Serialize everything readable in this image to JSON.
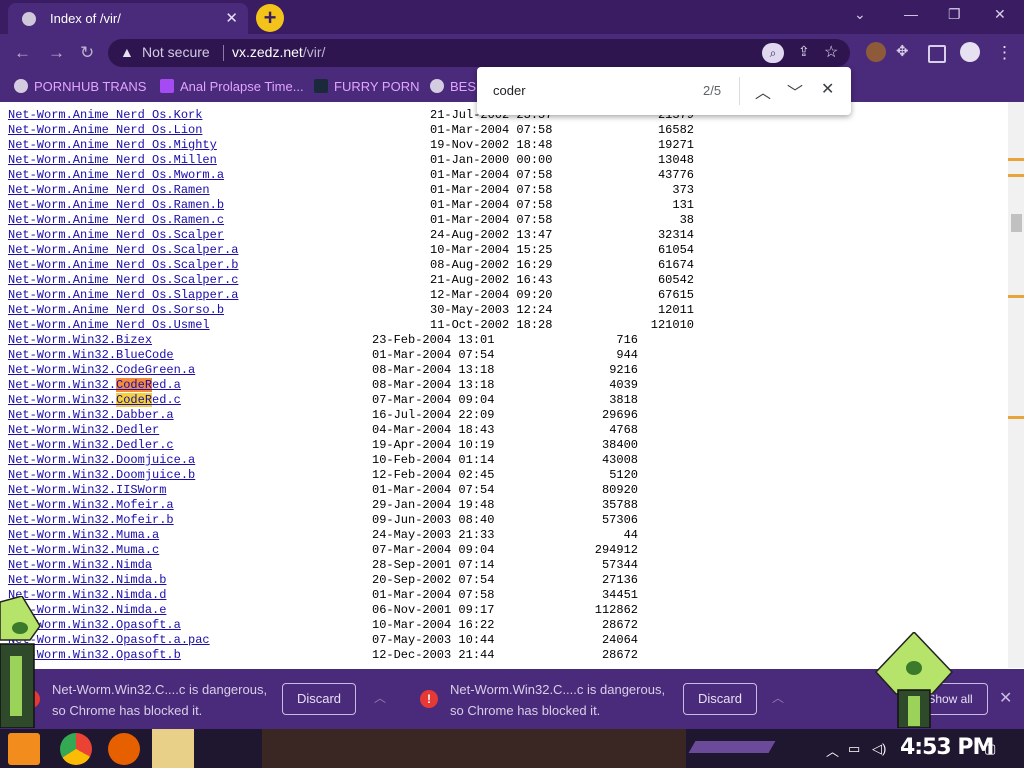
{
  "tab": {
    "title": "Index of /vir/",
    "close": "✕"
  },
  "toolbar": {
    "not_secure": "Not secure",
    "url_host": "vx.zedz.net",
    "url_path": "/vir/"
  },
  "bookmarks": [
    {
      "label": "PORNHUB TRANS"
    },
    {
      "label": "Anal Prolapse Time..."
    },
    {
      "label": "FURRY PORN"
    },
    {
      "label": "BES"
    }
  ],
  "find": {
    "query": "coder",
    "count": "2/5"
  },
  "listing_a": [
    {
      "name": "Net-Worm.Anime Nerd Os.Kork",
      "date": "21-Jul-2002 23:57",
      "size": "21379"
    },
    {
      "name": "Net-Worm.Anime Nerd Os.Lion",
      "date": "01-Mar-2004 07:58",
      "size": "16582"
    },
    {
      "name": "Net-Worm.Anime Nerd Os.Mighty",
      "date": "19-Nov-2002 18:48",
      "size": "19271"
    },
    {
      "name": "Net-Worm.Anime Nerd Os.Millen",
      "date": "01-Jan-2000 00:00",
      "size": "13048"
    },
    {
      "name": "Net-Worm.Anime Nerd Os.Mworm.a",
      "date": "01-Mar-2004 07:58",
      "size": "43776"
    },
    {
      "name": "Net-Worm.Anime Nerd Os.Ramen",
      "date": "01-Mar-2004 07:58",
      "size": "373"
    },
    {
      "name": "Net-Worm.Anime Nerd Os.Ramen.b",
      "date": "01-Mar-2004 07:58",
      "size": "131"
    },
    {
      "name": "Net-Worm.Anime Nerd Os.Ramen.c",
      "date": "01-Mar-2004 07:58",
      "size": "38"
    },
    {
      "name": "Net-Worm.Anime Nerd Os.Scalper",
      "date": "24-Aug-2002 13:47",
      "size": "32314"
    },
    {
      "name": "Net-Worm.Anime Nerd Os.Scalper.a",
      "date": "10-Mar-2004 15:25",
      "size": "61054"
    },
    {
      "name": "Net-Worm.Anime Nerd Os.Scalper.b",
      "date": "08-Aug-2002 16:29",
      "size": "61674"
    },
    {
      "name": "Net-Worm.Anime Nerd Os.Scalper.c",
      "date": "21-Aug-2002 16:43",
      "size": "60542"
    },
    {
      "name": "Net-Worm.Anime Nerd Os.Slapper.a",
      "date": "12-Mar-2004 09:20",
      "size": "67615"
    },
    {
      "name": "Net-Worm.Anime Nerd Os.Sorso.b",
      "date": "30-May-2003 12:24",
      "size": "12011"
    },
    {
      "name": "Net-Worm.Anime Nerd Os.Usmel",
      "date": "11-Oct-2002 18:28",
      "size": "121010"
    }
  ],
  "listing_b": [
    {
      "name": "Net-Worm.Win32.Bizex",
      "date": "23-Feb-2004 13:01",
      "size": "716"
    },
    {
      "name": "Net-Worm.Win32.BlueCode",
      "date": "01-Mar-2004 07:54",
      "size": "944"
    },
    {
      "name": "Net-Worm.Win32.CodeGreen.a",
      "date": "08-Mar-2004 13:18",
      "size": "9216"
    },
    {
      "name": "Net-Worm.Win32.CodeRed.a",
      "date": "08-Mar-2004 13:18",
      "size": "4039"
    },
    {
      "name": "Net-Worm.Win32.CodeRed.c",
      "date": "07-Mar-2004 09:04",
      "size": "3818"
    },
    {
      "name": "Net-Worm.Win32.Dabber.a",
      "date": "16-Jul-2004 22:09",
      "size": "29696"
    },
    {
      "name": "Net-Worm.Win32.Dedler",
      "date": "04-Mar-2004 18:43",
      "size": "4768"
    },
    {
      "name": "Net-Worm.Win32.Dedler.c",
      "date": "19-Apr-2004 10:19",
      "size": "38400"
    },
    {
      "name": "Net-Worm.Win32.Doomjuice.a",
      "date": "10-Feb-2004 01:14",
      "size": "43008"
    },
    {
      "name": "Net-Worm.Win32.Doomjuice.b",
      "date": "12-Feb-2004 02:45",
      "size": "5120"
    },
    {
      "name": "Net-Worm.Win32.IISWorm",
      "date": "01-Mar-2004 07:54",
      "size": "80920"
    },
    {
      "name": "Net-Worm.Win32.Mofeir.a",
      "date": "29-Jan-2004 19:48",
      "size": "35788"
    },
    {
      "name": "Net-Worm.Win32.Mofeir.b",
      "date": "09-Jun-2003 08:40",
      "size": "57306"
    },
    {
      "name": "Net-Worm.Win32.Muma.a",
      "date": "24-May-2003 21:33",
      "size": "44"
    },
    {
      "name": "Net-Worm.Win32.Muma.c",
      "date": "07-Mar-2004 09:04",
      "size": "294912"
    },
    {
      "name": "Net-Worm.Win32.Nimda",
      "date": "28-Sep-2001 07:14",
      "size": "57344"
    },
    {
      "name": "Net-Worm.Win32.Nimda.b",
      "date": "20-Sep-2002 07:54",
      "size": "27136"
    },
    {
      "name": "Net-Worm.Win32.Nimda.d",
      "date": "01-Mar-2004 07:58",
      "size": "34451"
    },
    {
      "name": "Net-Worm.Win32.Nimda.e",
      "date": "06-Nov-2001 09:17",
      "size": "112862"
    },
    {
      "name": "Net-Worm.Win32.Opasoft.a",
      "date": "10-Mar-2004 16:22",
      "size": "28672"
    },
    {
      "name": "Net-Worm.Win32.Opasoft.a.pac",
      "date": "07-May-2003 10:44",
      "size": "24064"
    },
    {
      "name": "Net-Worm.Win32.Opasoft.b",
      "date": "12-Dec-2003 21:44",
      "size": "28672"
    }
  ],
  "downloads": [
    {
      "line1": "Net-Worm.Win32.C....c is dangerous,",
      "line2": "so Chrome has blocked it.",
      "action": "Discard"
    },
    {
      "line1": "Net-Worm.Win32.C....c is dangerous,",
      "line2": "so Chrome has blocked it.",
      "action": "Discard"
    }
  ],
  "show_all": "Show all",
  "taskbar": {
    "time": "4:53 PM"
  },
  "colors": {
    "chrome_dark": "#3a1c63",
    "chrome": "#4a2a7a",
    "link": "#1a0dab",
    "find_match": "#f5d23b",
    "find_current": "#f58b3c",
    "danger": "#e53935"
  }
}
